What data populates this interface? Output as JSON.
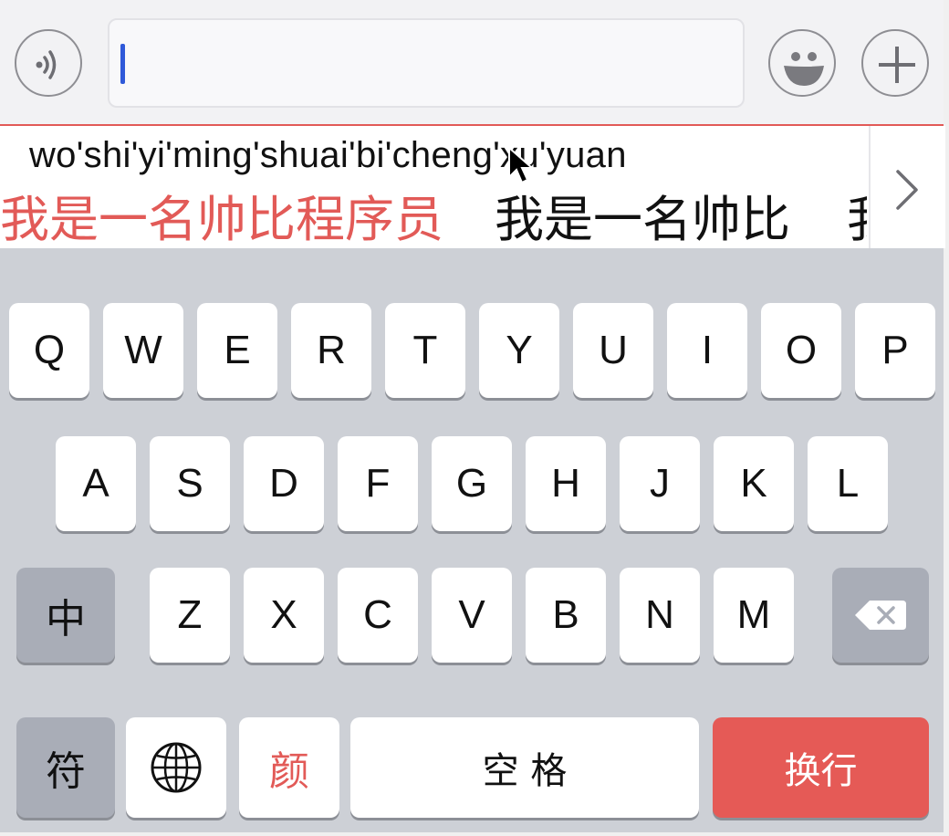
{
  "input_bar": {
    "voice_icon": "voice-wave-icon",
    "emoji_icon": "smiley-face-icon",
    "plus_icon": "plus-icon",
    "text_value": ""
  },
  "candidates": {
    "pinyin": "wo'shi'yi'ming'shuai'bi'cheng'xu'yuan",
    "items": [
      "我是一名帅比程序员",
      "我是一名帅比",
      "我"
    ],
    "more_icon": "chevron-right-icon"
  },
  "keyboard": {
    "row1": [
      "Q",
      "W",
      "E",
      "R",
      "T",
      "Y",
      "U",
      "I",
      "O",
      "P"
    ],
    "row2": [
      "A",
      "S",
      "D",
      "F",
      "G",
      "H",
      "J",
      "K",
      "L"
    ],
    "row3": [
      "Z",
      "X",
      "C",
      "V",
      "B",
      "N",
      "M"
    ],
    "lang_key": "中",
    "backspace_icon": "backspace-icon",
    "symbol_key": "符",
    "globe_icon": "globe-icon",
    "emoticon_key": "颜",
    "space_key": "空 格",
    "return_key": "换行"
  },
  "colors": {
    "accent_red": "#e25a57",
    "caret_blue": "#2f59d9",
    "keyboard_bg": "#cdd0d6",
    "special_key_gray": "#a9adb7"
  }
}
